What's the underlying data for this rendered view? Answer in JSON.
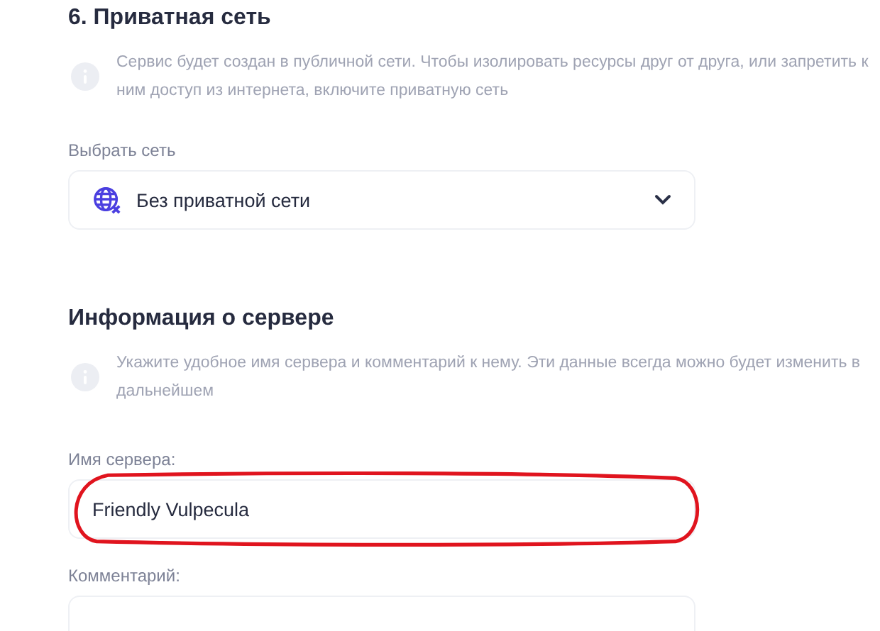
{
  "sections": [
    {
      "title": "6. Приватная сеть",
      "info": "Сервис будет создан в публичной сети. Чтобы изолировать ресурсы друг от друга, или запретить к ним доступ из интернета, включите приватную сеть",
      "fields": [
        {
          "kind": "select",
          "label": "Выбрать сеть",
          "value": "Без приватной сети",
          "highlighted": false
        }
      ]
    },
    {
      "title": "Информация о сервере",
      "info": "Укажите удобное имя сервера и комментарий к нему. Эти данные всегда можно будет изменить в дальнейшем",
      "fields": [
        {
          "kind": "input",
          "label": "Имя сервера:",
          "value": "Friendly Vulpecula",
          "highlighted": true
        },
        {
          "kind": "textarea",
          "label": "Комментарий:",
          "highlighted": false
        }
      ]
    }
  ]
}
